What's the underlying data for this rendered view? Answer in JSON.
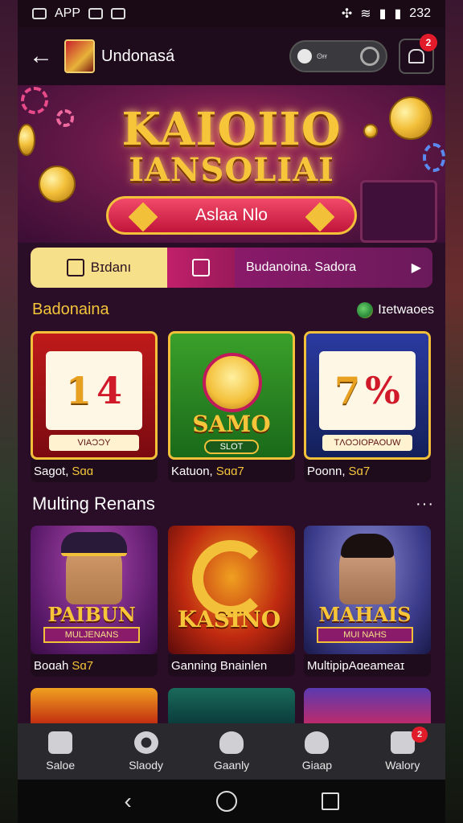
{
  "status_bar": {
    "app_label": "APP",
    "time": "232"
  },
  "app_bar": {
    "title": "Undonasá",
    "search_placeholder": "ʘɍɍ",
    "notif_count": "2"
  },
  "hero": {
    "title_line1": "KAIOIIO",
    "title_line2": "IANSOLIAI",
    "cta_label": "Aslaa Nlo"
  },
  "tabs": {
    "active_label": "Bɪdanı",
    "info_label": "Budanoina. Sadora"
  },
  "section1": {
    "title": "Badonaina",
    "right_label": "Iɪetwaoes",
    "games": [
      {
        "reel1": "1",
        "reel2": "4",
        "label": "VIAƆƆY",
        "caption": "Sagot,",
        "caption_gold": "Sɑɑ"
      },
      {
        "logo_text": "SAMO",
        "pill": "SLOT",
        "caption": "Katuon,",
        "caption_gold": "Sɑɑ7"
      },
      {
        "reel1": "7",
        "reel2": "%",
        "label": "TɅOƆIOPAOUW",
        "caption": "Poonn,",
        "caption_gold": "Sɑ7"
      }
    ]
  },
  "section2": {
    "title": "Multing Renans",
    "games": [
      {
        "logo_text": "PAIBUN",
        "sub": "MULJENANS",
        "caption": "Boɑah",
        "caption_gold": "Sɑ7"
      },
      {
        "logo_text": "KASINO",
        "caption": "Ganning Bnainlen",
        "caption_gold": ""
      },
      {
        "logo_text": "MAHAIS",
        "sub": "MUI NAHS",
        "caption": "MultipipAɑeameaɪ",
        "caption_gold": ""
      }
    ]
  },
  "bottom_nav": {
    "items": [
      {
        "label": "Saloe",
        "icon": "puzzle-icon"
      },
      {
        "label": "Slaody",
        "icon": "gear-icon"
      },
      {
        "label": "Gaanly",
        "icon": "home-icon"
      },
      {
        "label": "Giaap",
        "icon": "heart-icon"
      },
      {
        "label": "Walory",
        "icon": "wallet-icon",
        "badge": "2"
      }
    ]
  },
  "colors": {
    "accent_gold": "#f3c53a",
    "badge_red": "#e21b2b",
    "bg": "#2a0d26"
  }
}
